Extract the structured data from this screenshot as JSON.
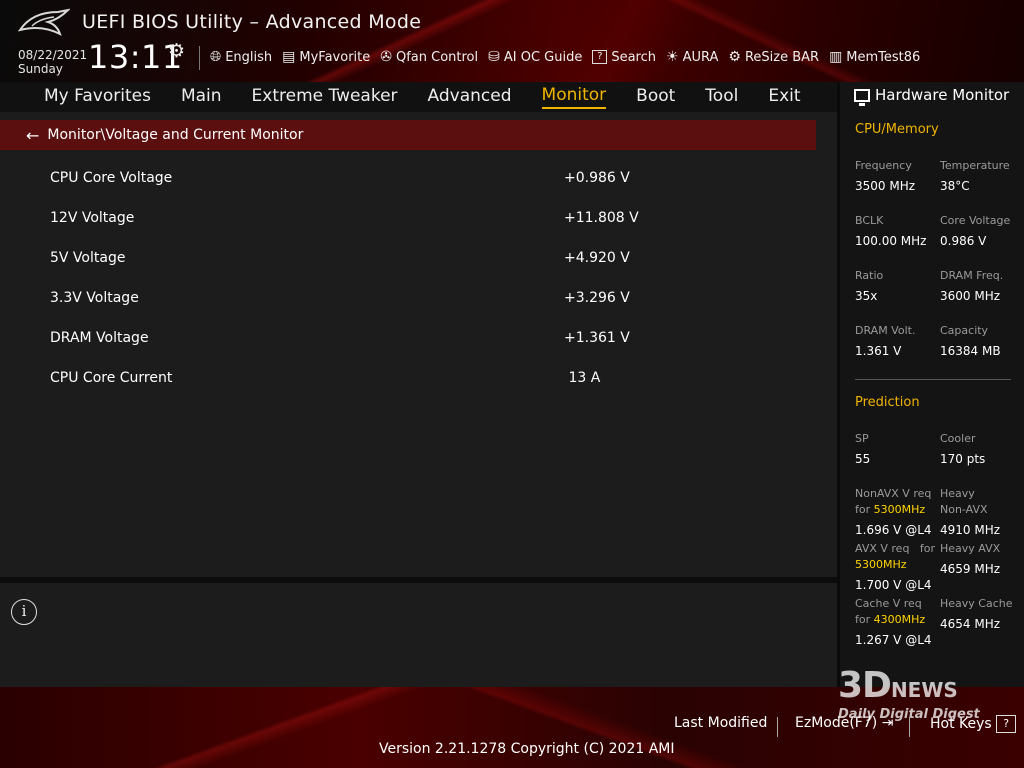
{
  "header": {
    "title": "UEFI BIOS Utility – Advanced Mode",
    "date": "08/22/2021",
    "day": "Sunday",
    "time": "13:11",
    "toolbar": [
      {
        "icon": "globe-icon",
        "label": "English"
      },
      {
        "icon": "favorite-list-icon",
        "label": "MyFavorite"
      },
      {
        "icon": "fan-icon",
        "label": "Qfan Control"
      },
      {
        "icon": "ai-oc-icon",
        "label": "AI OC Guide"
      },
      {
        "icon": "search-help-icon",
        "label": "Search"
      },
      {
        "icon": "aura-light-icon",
        "label": "AURA"
      },
      {
        "icon": "resize-bar-icon",
        "label": "ReSize BAR"
      },
      {
        "icon": "memtest-icon",
        "label": "MemTest86"
      }
    ]
  },
  "nav": {
    "items": [
      "My Favorites",
      "Main",
      "Extreme Tweaker",
      "Advanced",
      "Monitor",
      "Boot",
      "Tool",
      "Exit"
    ],
    "active": "Monitor"
  },
  "main": {
    "breadcrumb": "Monitor\\Voltage and Current Monitor",
    "rows": [
      {
        "label": "CPU Core Voltage",
        "value": "+0.986 V"
      },
      {
        "label": "12V Voltage",
        "value": "+11.808 V"
      },
      {
        "label": "5V Voltage",
        "value": "+4.920 V"
      },
      {
        "label": "3.3V Voltage",
        "value": "+3.296 V"
      },
      {
        "label": "DRAM Voltage",
        "value": "+1.361 V"
      },
      {
        "label": "CPU Core Current",
        "value": " 13 A"
      }
    ]
  },
  "hw": {
    "title": "Hardware Monitor",
    "cpu_section": "CPU/Memory",
    "cpu": [
      {
        "label": "Frequency",
        "value": "3500 MHz"
      },
      {
        "label": "Temperature",
        "value": "38°C"
      },
      {
        "label": "BCLK",
        "value": "100.00 MHz"
      },
      {
        "label": "Core Voltage",
        "value": "0.986 V"
      },
      {
        "label": "Ratio",
        "value": "35x"
      },
      {
        "label": "DRAM Freq.",
        "value": "3600 MHz"
      },
      {
        "label": "DRAM Volt.",
        "value": "1.361 V"
      },
      {
        "label": "Capacity",
        "value": "16384 MB"
      }
    ],
    "prediction_section": "Prediction",
    "sp_label": "SP",
    "sp_value": "55",
    "cooler_label": "Cooler",
    "cooler_value": "170 pts",
    "nonavx_label_a": "NonAVX V req",
    "nonavx_label_b": "for",
    "nonavx_freq": "5300MHz",
    "nonavx_value": "1.696 V @L4",
    "heavy_nonavx_label_a": "Heavy",
    "heavy_nonavx_label_b": "Non-AVX",
    "heavy_nonavx_value": "4910 MHz",
    "avx_label_a": "AVX V req",
    "avx_label_b": "for",
    "avx_freq": "5300MHz",
    "avx_value": "1.700 V @L4",
    "heavy_avx_label": "Heavy AVX",
    "heavy_avx_value": "4659 MHz",
    "cache_label_a": "Cache V req",
    "cache_label_b": "for",
    "cache_freq": "4300MHz",
    "cache_value": "1.267 V @L4",
    "heavy_cache_label": "Heavy Cache",
    "heavy_cache_value": "4654 MHz"
  },
  "footer": {
    "last_modified": "Last Modified",
    "ezmode": "EzMode(F7)",
    "ezmode_icon": "ezmode-exit-icon",
    "hotkeys": "Hot Keys",
    "hotkeys_key": "?",
    "version": "Version 2.21.1278 Copyright (C) 2021 AMI"
  },
  "watermark": {
    "line1": "3D",
    "line1b": "NEWS",
    "line2": "Daily Digital Digest"
  }
}
